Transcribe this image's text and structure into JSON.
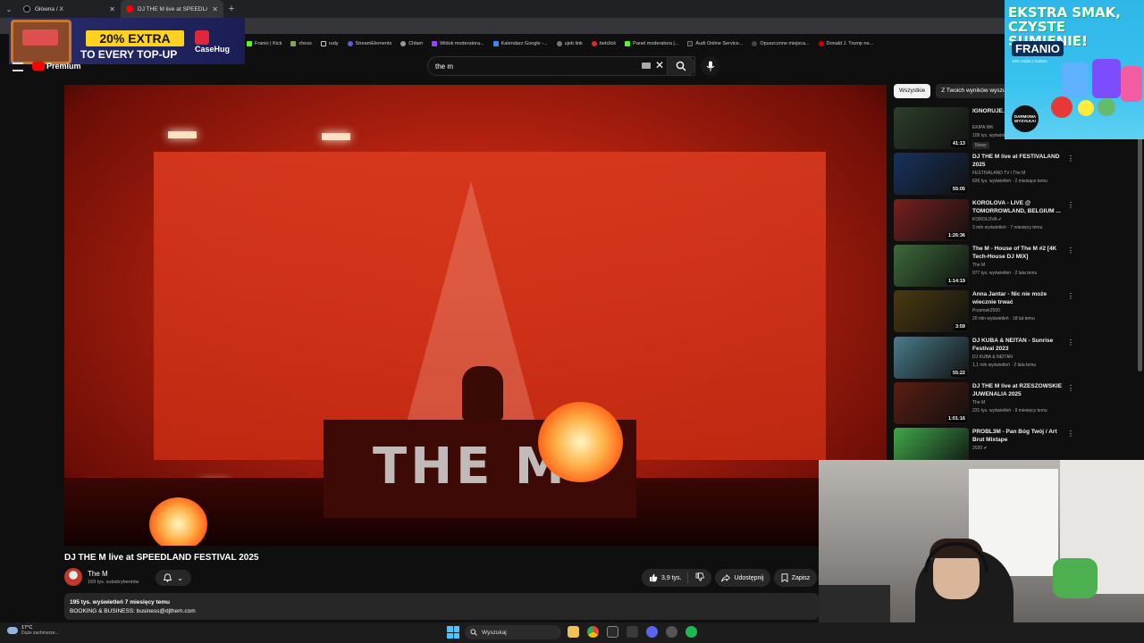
{
  "browser": {
    "tabs": [
      {
        "title": "Główna / X",
        "active": false
      },
      {
        "title": "DJ THE M live at SPEEDLAND F...",
        "active": true
      }
    ],
    "bookmarks": [
      "Franio | Kick",
      "chess",
      "rudy",
      "StreamElements",
      "Chłam",
      "Widok moderatora...",
      "Kalendarz Google -...",
      "ujeb link",
      "betclick",
      "Panel moderatora |...",
      "Audi Online Service...",
      "Opuszczone miejsca...",
      "Donald J. Trump ne..."
    ]
  },
  "ad_casehug": {
    "line1": "20% EXTRA",
    "line2": "TO EVERY TOP-UP",
    "brand": "CaseHug"
  },
  "ad_franio": {
    "headline": "EKSTRA SMAK, CZYSTE SUMIENIE!",
    "brand": "FRANIO",
    "sub": "10% zniżki z kodem",
    "badge": "DARMOWA WYSYŁKA!"
  },
  "youtube": {
    "logo_label": "Premium",
    "search_value": "the m",
    "video": {
      "title": "DJ THE M live at SPEEDLAND FESTIVAL 2025",
      "stage_logo": "THE M",
      "channel": "The M",
      "subscribers": "169 tys. subskrybentów",
      "likes": "3,9 tys.",
      "share_label": "Udostępnij",
      "save_label": "Zapisz",
      "views_meta": "195 tys. wyświetleń  7 miesięcy temu",
      "description": "BOOKING & BUSINESS: business@djthem.com"
    },
    "chips": [
      "Wszystkie",
      "Z Twoich wyników wyszukiwania"
    ],
    "recommendations": [
      {
        "title": "IGNORUJE... 24H",
        "channel": "EKIPA WK",
        "meta": "109 tys. wyświetleń",
        "duration": "41:13",
        "badge": "Nowy",
        "color": "#2c3e2a"
      },
      {
        "title": "DJ THE M live at FESTIVALAND 2025",
        "channel": "FESTIVALAND TV i The M",
        "meta": "626 tys. wyświetleń · 2 miesiące temu",
        "duration": "55:05",
        "badge": "",
        "color": "#17325c"
      },
      {
        "title": "KOROLOVA - LIVE @ TOMORROWLAND, BELGIUM ...",
        "channel": "KOROLOVA ✔",
        "meta": "3 mln wyświetleń · 7 miesięcy temu",
        "duration": "1:26:36",
        "badge": "",
        "color": "#7a1f1f"
      },
      {
        "title": "The M - House of The M #2 [4K Tech-House DJ MIX]",
        "channel": "The M",
        "meta": "977 tys. wyświetleń · 2 lata temu",
        "duration": "1:14:19",
        "badge": "",
        "color": "#3d6b3a"
      },
      {
        "title": "Anna Jantar - Nic nie może wiecznie trwać",
        "channel": "Przemek2500",
        "meta": "20 mln wyświetleń · 18 lat temu",
        "duration": "3:59",
        "badge": "",
        "color": "#4a3a10"
      },
      {
        "title": "DJ KUBA & NEITAN - Sunrise Festival 2023",
        "channel": "DJ KUBA & NEITAN",
        "meta": "1,1 mln wyświetleń · 2 lata temu",
        "duration": "55:22",
        "badge": "",
        "color": "#4a7b8a"
      },
      {
        "title": "DJ THE M live at RZESZOWSKIE JUWENALIA 2025",
        "channel": "The M",
        "meta": "231 tys. wyświetleń · 9 miesięcy temu",
        "duration": "1:01:16",
        "badge": "",
        "color": "#5a1d12"
      },
      {
        "title": "PROBL3M - Pan Bóg Twój / Art Brut Mixtape",
        "channel": "2020 ✔",
        "meta": "",
        "duration": "",
        "badge": "",
        "color": "#3fa84a"
      }
    ]
  },
  "taskbar": {
    "temp": "17°C",
    "condition": "Duże zachmurze...",
    "search_label": "Wyszukaj"
  },
  "colors": {
    "accent_red": "#ff0000",
    "bg": "#0f0f0f",
    "chip_bg": "#272727"
  }
}
